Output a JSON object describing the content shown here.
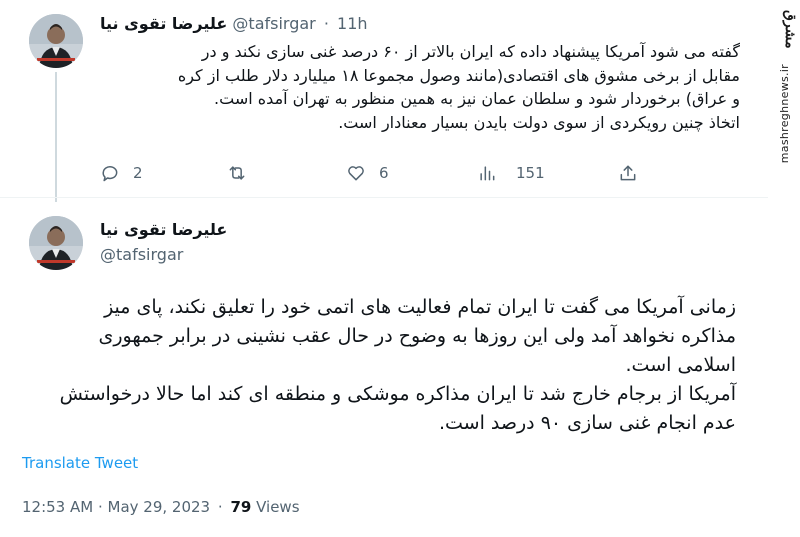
{
  "tweet_quoted": {
    "display_name": "علیرضا تقوی نیا",
    "handle": "@tafsirgar",
    "separator": "·",
    "time": "11h",
    "lines": [
      "گفته می شود آمریکا پیشنهاد داده که ایران بالاتر از ۶۰ درصد غنی سازی نکند و در",
      "مقابل از برخی مشوق های اقتصادی(مانند وصول مجموعا ۱۸ میلیارد دلار طلب از کره",
      "و عراق) برخوردار شود و سلطان عمان نیز به همین منظور به تهران آمده است.",
      "اتخاذ چنین رویکردی از سوی دولت بایدن بسیار معنادار است."
    ],
    "actions": {
      "reply_count": "2",
      "retweet_count": "",
      "like_count": "6",
      "views_count": "151"
    }
  },
  "tweet_main": {
    "display_name": "علیرضا تقوی نیا",
    "handle": "@tafsirgar",
    "more_label": "···",
    "lines": [
      "زمانی آمریکا می گفت تا ایران تمام فعالیت های اتمی خود را تعلیق نکند، پای میز",
      "مذاکره نخواهد آمد ولی این روزها به وضوح در حال عقب نشینی در برابر جمهوری",
      "اسلامی است.",
      "آمریکا از برجام خارج شد تا ایران مذاکره موشکی و منطقه ای کند اما حالا درخواستش",
      "عدم انجام غنی سازی ۹۰ درصد است."
    ],
    "translate_label": "Translate Tweet",
    "timestamp": "12:53 AM · May 29, 2023",
    "meta_separator": "·",
    "views_count": "79",
    "views_label": "Views"
  },
  "watermark": {
    "logo_text": "مشرق",
    "url": "mashreghnews.ir"
  },
  "colors": {
    "accent": "#1d9bf0",
    "secondary_text": "#536471",
    "primary_text": "#0f1419",
    "divider": "#eff3f4"
  }
}
